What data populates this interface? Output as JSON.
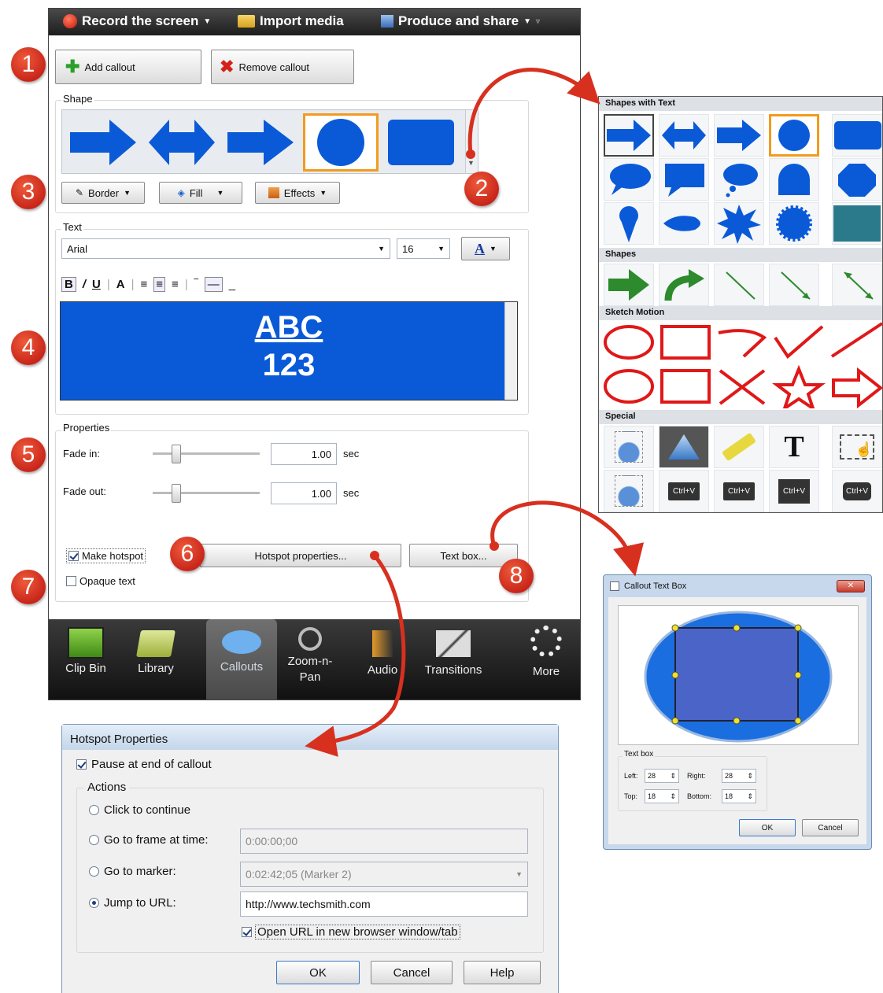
{
  "toolbar": {
    "record": "Record the screen",
    "import": "Import media",
    "produce": "Produce and share"
  },
  "callout_panel": {
    "add_callout": "Add callout",
    "remove_callout": "Remove callout",
    "shape_label": "Shape",
    "border": "Border",
    "fill": "Fill",
    "effects": "Effects",
    "text_label": "Text",
    "font": "Arial",
    "size": "16",
    "preview_line1": "ABC",
    "preview_line2": "123",
    "properties_label": "Properties",
    "fade_in_label": "Fade in:",
    "fade_in_value": "1.00",
    "fade_out_label": "Fade out:",
    "fade_out_value": "1.00",
    "sec": "sec",
    "make_hotspot": "Make hotspot",
    "opaque_text": "Opaque text",
    "hotspot_properties_btn": "Hotspot properties...",
    "text_box_btn": "Text box..."
  },
  "tabs": [
    {
      "label": "Clip Bin"
    },
    {
      "label": "Library"
    },
    {
      "label": "Callouts"
    },
    {
      "label": "Zoom-n-Pan"
    },
    {
      "label": "Audio"
    },
    {
      "label": "Transitions"
    },
    {
      "label": "More"
    }
  ],
  "badges": [
    "1",
    "2",
    "3",
    "4",
    "5",
    "6",
    "7",
    "8"
  ],
  "shapes_panel": {
    "shapes_with_text": "Shapes with Text",
    "shapes": "Shapes",
    "sketch_motion": "Sketch Motion",
    "special": "Special",
    "text_glyph": "T",
    "ctrl_v": "Ctrl+V"
  },
  "text_box_dialog": {
    "title": "Callout Text Box",
    "group": "Text box",
    "left_label": "Left:",
    "left": "28",
    "right_label": "Right:",
    "right": "28",
    "top_label": "Top:",
    "top": "18",
    "bottom_label": "Bottom:",
    "bottom": "18",
    "ok": "OK",
    "cancel": "Cancel"
  },
  "hotspot_dialog": {
    "title": "Hotspot Properties",
    "pause": "Pause at end of callout",
    "actions": "Actions",
    "click_continue": "Click to continue",
    "goto_frame": "Go to frame at time:",
    "frame_time": "0:00:00;00",
    "goto_marker": "Go to marker:",
    "marker": "0:02:42;05 (Marker 2)",
    "jump_url": "Jump to URL:",
    "url": "http://www.techsmith.com",
    "open_new": "Open URL in new browser window/tab",
    "ok": "OK",
    "cancel": "Cancel",
    "help": "Help"
  },
  "colors": {
    "accent_blue": "#0a5ad8",
    "badge_red": "#d8301f",
    "selection_orange": "#f39a1e"
  }
}
